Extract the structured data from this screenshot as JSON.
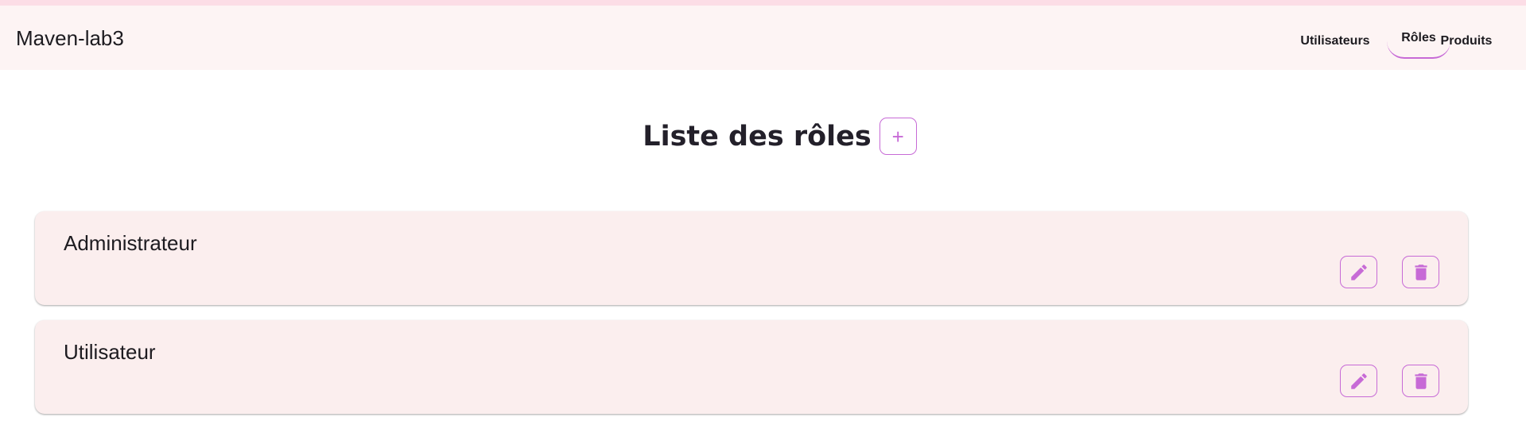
{
  "app": {
    "title": "Maven-lab3"
  },
  "nav": {
    "tabs": [
      {
        "label": "Utilisateurs",
        "active": false
      },
      {
        "label": "Rôles",
        "active": true
      },
      {
        "label": "Produits",
        "active": false
      }
    ]
  },
  "page": {
    "heading": "Liste des rôles",
    "add_button_icon": "plus-icon"
  },
  "roles": [
    {
      "name": "Administrateur",
      "edit_icon": "pencil-icon",
      "delete_icon": "trash-icon"
    },
    {
      "name": "Utilisateur",
      "edit_icon": "pencil-icon",
      "delete_icon": "trash-icon"
    }
  ],
  "colors": {
    "accent": "#c76ad6",
    "appbar_bg": "#fdf4f4",
    "card_bg": "#fbeeee",
    "top_stripe": "#fcdde6"
  }
}
